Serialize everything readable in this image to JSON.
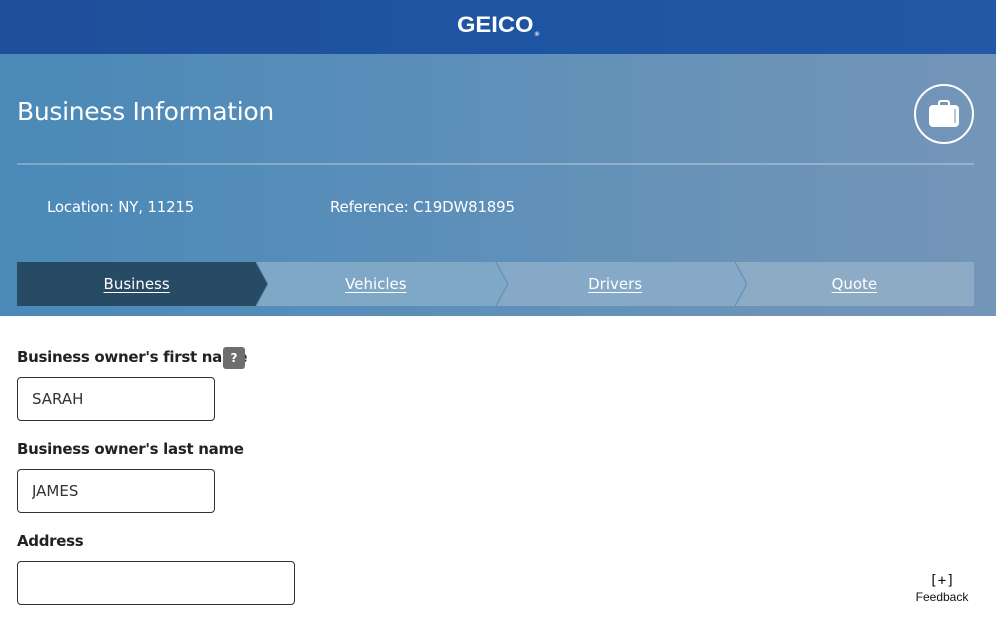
{
  "header": {
    "brand": "GEICO",
    "brand_mark": "®"
  },
  "hero": {
    "title": "Business Information",
    "badge_icon": "briefcase-icon",
    "location": "Location: NY, 11215",
    "reference": "Reference: C19DW81895"
  },
  "steps": [
    {
      "label": "Business",
      "state": "active"
    },
    {
      "label": "Vehicles",
      "state": "inactive"
    },
    {
      "label": "Drivers",
      "state": "inactive"
    },
    {
      "label": "Quote",
      "state": "inactive"
    }
  ],
  "form": {
    "first_name": {
      "label": "Business owner's first name",
      "value": "SARAH",
      "help": "?"
    },
    "last_name": {
      "label": "Business owner's last name",
      "value": "JAMES"
    },
    "address": {
      "label": "Address",
      "value": ""
    }
  },
  "feedback": {
    "icon": "[+]",
    "label": "Feedback"
  },
  "colors": {
    "brand_blue": "#1f4e9a",
    "active_step": "#274a65",
    "inactive_step": "#84a9c7"
  }
}
